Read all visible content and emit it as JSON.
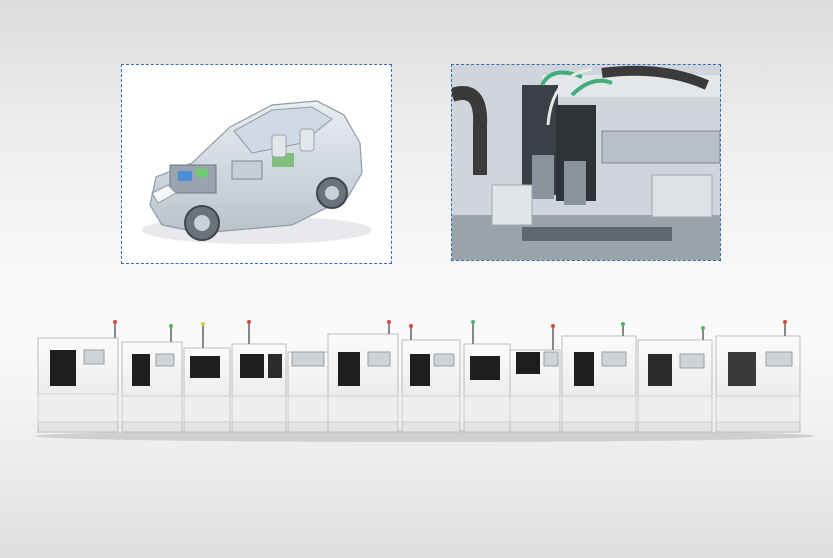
{
  "image_1": {
    "description_name": "automotive-cutaway-car"
  },
  "image_2": {
    "description_name": "dispensing-machine-closeup"
  },
  "production_line": {
    "machine_count": 12
  },
  "colors": {
    "frame_border": "#2f6fb3",
    "machine_body": "#f2f2f2",
    "window_dark": "#1e1e1e",
    "signal_red": "#d84a3a",
    "signal_green": "#4fb35a",
    "signal_yellow": "#e8c23a"
  }
}
